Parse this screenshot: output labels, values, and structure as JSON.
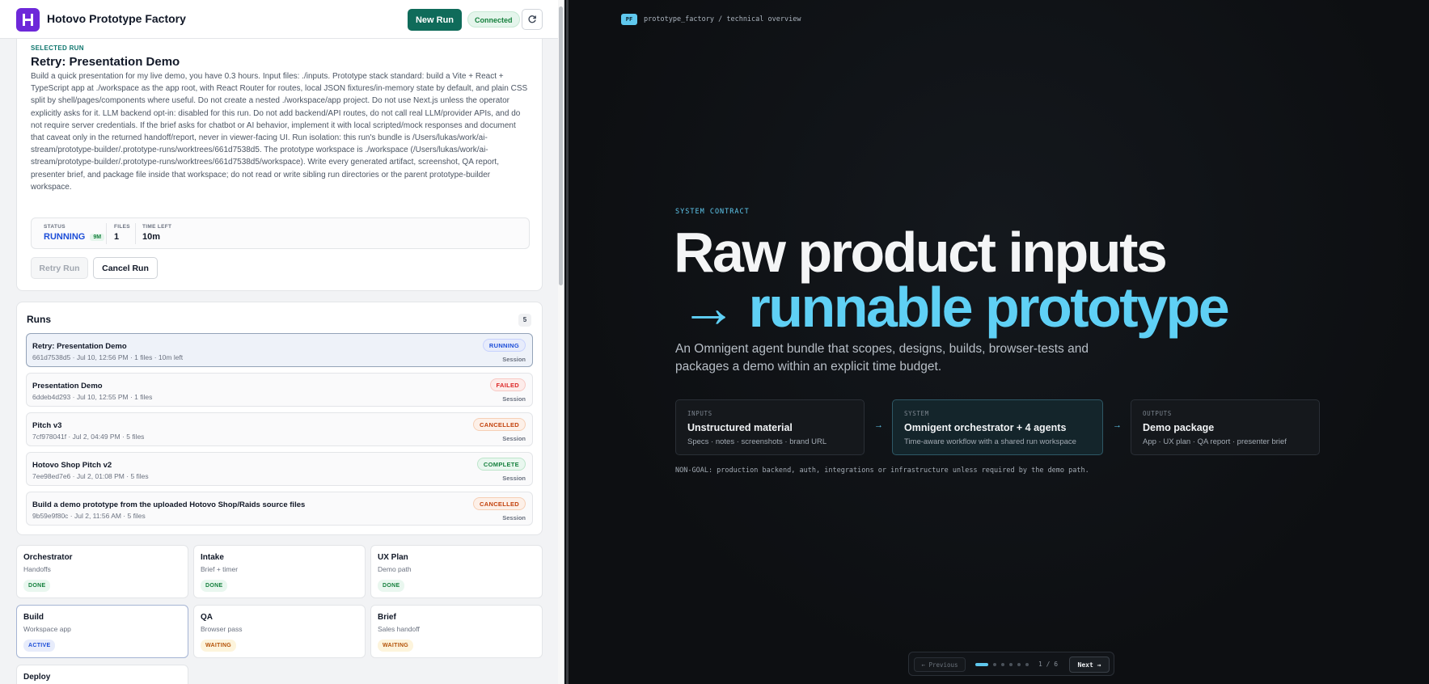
{
  "app": {
    "title": "Hotovo Prototype Factory",
    "new_run": "New Run",
    "connection": "Connected"
  },
  "selected": {
    "kicker": "SELECTED RUN",
    "title": "Retry: Presentation Demo",
    "description": "Build a quick presentation for my live demo, you have 0.3 hours. Input files: ./inputs. Prototype stack standard: build a Vite + React + TypeScript app at ./workspace as the app root, with React Router for routes, local JSON fixtures/in-memory state by default, and plain CSS split by shell/pages/components where useful. Do not create a nested ./workspace/app project. Do not use Next.js unless the operator explicitly asks for it. LLM backend opt-in: disabled for this run. Do not add backend/API routes, do not call real LLM/provider APIs, and do not require server credentials. If the brief asks for chatbot or AI behavior, implement it with local scripted/mock responses and document that caveat only in the returned handoff/report, never in viewer-facing UI. Run isolation: this run's bundle is /Users/lukas/work/ai-stream/prototype-builder/.prototype-runs/worktrees/661d7538d5. The prototype workspace is ./workspace (/Users/lukas/work/ai-stream/prototype-builder/.prototype-runs/worktrees/661d7538d5/workspace). Write every generated artifact, screenshot, QA report, presenter brief, and package file inside that workspace; do not read or write sibling run directories or the parent prototype-builder workspace.",
    "status_label": "STATUS",
    "status_value": "RUNNING",
    "status_chip": "9M",
    "files_label": "FILES",
    "files_value": "1",
    "time_label": "TIME LEFT",
    "time_value": "10m",
    "retry_label": "Retry Run",
    "cancel_label": "Cancel Run"
  },
  "runs": {
    "title": "Runs",
    "count": "5",
    "items": [
      {
        "name": "Retry: Presentation Demo",
        "meta": "661d7538d5 · Jul 10, 12:56 PM · 1 files · 10m left",
        "status": "RUNNING",
        "kind": "Session"
      },
      {
        "name": "Presentation Demo",
        "meta": "6ddeb4d293 · Jul 10, 12:55 PM · 1 files",
        "status": "FAILED",
        "kind": "Session"
      },
      {
        "name": "Pitch v3",
        "meta": "7cf978041f · Jul 2, 04:49 PM · 5 files",
        "status": "CANCELLED",
        "kind": "Session"
      },
      {
        "name": "Hotovo Shop Pitch v2",
        "meta": "7ee98ed7e6 · Jul 2, 01:08 PM · 5 files",
        "status": "COMPLETE",
        "kind": "Session"
      },
      {
        "name": "Build a demo prototype from the uploaded Hotovo Shop/Raids source files",
        "meta": "9b59e9f80c · Jul 2, 11:56 AM · 5 files",
        "status": "CANCELLED",
        "kind": "Session"
      }
    ]
  },
  "agents": [
    {
      "name": "Orchestrator",
      "sub": "Handoffs",
      "status": "DONE"
    },
    {
      "name": "Intake",
      "sub": "Brief + timer",
      "status": "DONE"
    },
    {
      "name": "UX Plan",
      "sub": "Demo path",
      "status": "DONE"
    },
    {
      "name": "Build",
      "sub": "Workspace app",
      "status": "ACTIVE"
    },
    {
      "name": "QA",
      "sub": "Browser pass",
      "status": "WAITING"
    },
    {
      "name": "Brief",
      "sub": "Sales handoff",
      "status": "WAITING"
    },
    {
      "name": "Deploy",
      "sub": "",
      "status": ""
    }
  ],
  "slide": {
    "tag": "PF",
    "breadcrumb": "prototype_factory / technical overview",
    "kicker": "SYSTEM CONTRACT",
    "headline_1": "Raw product inputs",
    "headline_2": "→ runnable prototype",
    "lead": "An Omnigent agent bundle that scopes, designs, builds, browser-tests and packages a demo within an explicit time budget.",
    "flow": [
      {
        "kicker": "INPUTS",
        "title": "Unstructured material",
        "sub": "Specs · notes · screenshots · brand URL"
      },
      {
        "kicker": "SYSTEM",
        "title": "Omnigent orchestrator + 4 agents",
        "sub": "Time-aware workflow with a shared run workspace"
      },
      {
        "kicker": "OUTPUTS",
        "title": "Demo package",
        "sub": "App · UX plan · QA report · presenter brief"
      }
    ],
    "arrow": "→",
    "nongoal": "NON-GOAL: production backend, auth, integrations or infrastructure unless required by the demo path.",
    "pager": {
      "prev": "← Previous",
      "count": "1 / 6",
      "next": "Next →",
      "current": 1,
      "total": 6
    }
  },
  "colors": {
    "accent_teal": "#0f6b5a",
    "accent_cyan": "#5fd0f5",
    "brand_purple": "#6d28d9"
  }
}
